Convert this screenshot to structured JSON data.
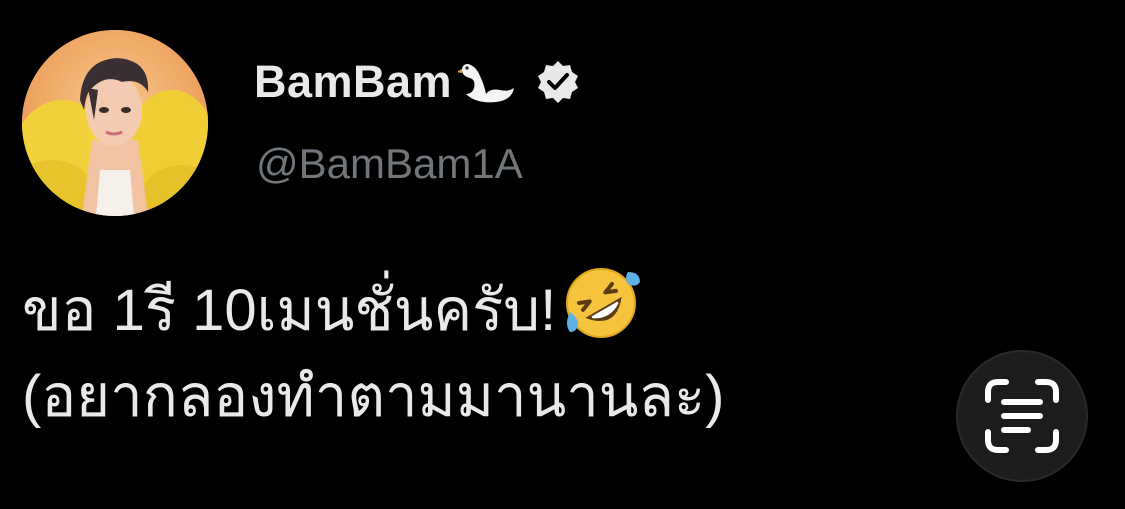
{
  "tweet": {
    "avatar_icon": "profile-photo",
    "display_name": "BamBam",
    "name_emoji_icon": "swan-icon",
    "verified_icon": "verified-badge-icon",
    "handle": "@BamBam1A",
    "text_line1": "ขอ 1รี 10เมนชั่นครับ!",
    "text_line1_emoji": "rolling-on-floor-laughing-icon",
    "text_line2": "(อยากลองทำตามมานานละ)"
  },
  "overlay": {
    "live_text_button_icon": "text-scan-icon"
  },
  "colors": {
    "background": "#000000",
    "primary_text": "#e7e9ea",
    "secondary_text": "#71767b",
    "overlay_button": "#1c1c1e"
  }
}
